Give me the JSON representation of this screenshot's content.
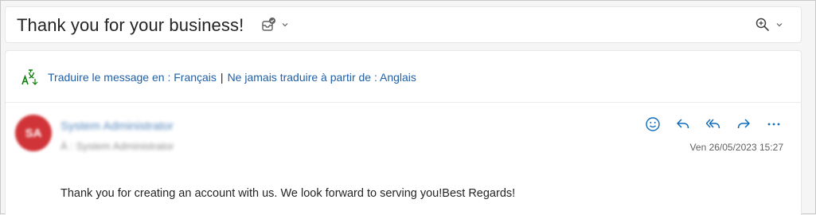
{
  "subject": {
    "title": "Thank you for your business!"
  },
  "translation": {
    "translate_link": "Traduire le message en : Français",
    "separator": "|",
    "never_link": "Ne jamais traduire à partir de : Anglais"
  },
  "message": {
    "sender_name": "System Administrator",
    "sender_to": "À : System Administrator",
    "avatar_initials": "SA",
    "avatar_color": "#d13438",
    "date": "Ven 26/05/2023 15:27",
    "body": "Thank you for creating an account with us. We look forward to serving you!Best Regards!"
  },
  "icons": {
    "subject_action": "mark-done-icon",
    "zoom": "zoom-icon",
    "translate": "translate-icon",
    "actions": [
      "emoji-reaction-icon",
      "reply-icon",
      "reply-all-icon",
      "forward-icon",
      "more-icon"
    ]
  },
  "colors": {
    "accent": "#1f5fa8",
    "action_icon": "#0f6cbd"
  }
}
